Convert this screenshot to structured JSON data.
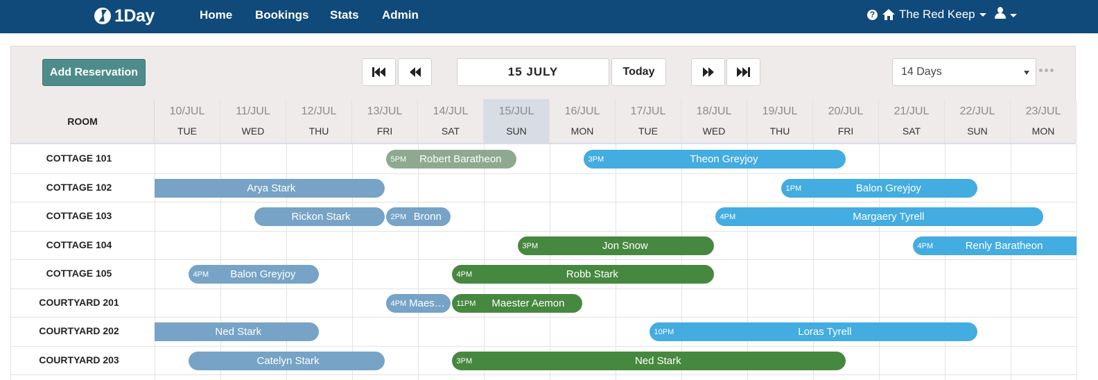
{
  "app": {
    "brand": "1Day"
  },
  "nav": {
    "home": "Home",
    "bookings": "Bookings",
    "stats": "Stats",
    "admin": "Admin"
  },
  "header": {
    "property": "The Red Keep",
    "help_glyph": "?"
  },
  "toolbar": {
    "add_reservation": "Add Reservation",
    "current_date": "15 JULY",
    "today": "Today",
    "range": "14 Days",
    "range_options": [
      "14 Days"
    ]
  },
  "grid": {
    "room_header": "ROOM",
    "today_index": 5,
    "days": [
      {
        "date": "10/JUL",
        "dow": "TUE"
      },
      {
        "date": "11/JUL",
        "dow": "WED"
      },
      {
        "date": "12/JUL",
        "dow": "THU"
      },
      {
        "date": "13/JUL",
        "dow": "FRI"
      },
      {
        "date": "14/JUL",
        "dow": "SAT"
      },
      {
        "date": "15/JUL",
        "dow": "SUN"
      },
      {
        "date": "16/JUL",
        "dow": "MON"
      },
      {
        "date": "17/JUL",
        "dow": "TUE"
      },
      {
        "date": "18/JUL",
        "dow": "WED"
      },
      {
        "date": "19/JUL",
        "dow": "THU"
      },
      {
        "date": "20/JUL",
        "dow": "FRI"
      },
      {
        "date": "21/JUL",
        "dow": "SAT"
      },
      {
        "date": "22/JUL",
        "dow": "SUN"
      },
      {
        "date": "23/JUL",
        "dow": "MON"
      }
    ],
    "rooms": [
      "COTTAGE 101",
      "COTTAGE 102",
      "COTTAGE 103",
      "COTTAGE 104",
      "COTTAGE 105",
      "COURTYARD 201",
      "COURTYARD 202",
      "COURTYARD 203"
    ]
  },
  "bookings": [
    {
      "room": 0,
      "start": 3.5,
      "end": 5.5,
      "time": "5PM",
      "name": "Robert Baratheon",
      "status": "pastgreen"
    },
    {
      "room": 0,
      "start": 6.5,
      "end": 10.5,
      "time": "3PM",
      "name": "Theon Greyjoy",
      "status": "future"
    },
    {
      "room": 1,
      "start": 0,
      "end": 3.5,
      "time": "",
      "name": "Arya Stark",
      "status": "past",
      "open": "left"
    },
    {
      "room": 1,
      "start": 9.5,
      "end": 12.5,
      "time": "1PM",
      "name": "Balon Greyjoy",
      "status": "future"
    },
    {
      "room": 2,
      "start": 1.5,
      "end": 3.5,
      "time": "",
      "name": "Rickon Stark",
      "status": "past"
    },
    {
      "room": 2,
      "start": 3.5,
      "end": 4.5,
      "time": "2PM",
      "name": "Bronn",
      "status": "past"
    },
    {
      "room": 2,
      "start": 8.5,
      "end": 13.5,
      "time": "4PM",
      "name": "Margaery Tyrell",
      "status": "future"
    },
    {
      "room": 3,
      "start": 5.5,
      "end": 8.5,
      "time": "3PM",
      "name": "Jon Snow",
      "status": "current"
    },
    {
      "room": 3,
      "start": 11.5,
      "end": 14,
      "time": "4PM",
      "name": "Renly Baratheon",
      "status": "future",
      "open": "right"
    },
    {
      "room": 4,
      "start": 0.5,
      "end": 2.5,
      "time": "4PM",
      "name": "Balon Greyjoy",
      "status": "past"
    },
    {
      "room": 4,
      "start": 4.5,
      "end": 8.5,
      "time": "4PM",
      "name": "Robb Stark",
      "status": "current"
    },
    {
      "room": 5,
      "start": 3.5,
      "end": 4.5,
      "time": "4PM",
      "name": "Maester Pycelle",
      "status": "past"
    },
    {
      "room": 5,
      "start": 4.5,
      "end": 6.5,
      "time": "11PM",
      "name": "Maester Aemon",
      "status": "current"
    },
    {
      "room": 6,
      "start": 0,
      "end": 2.5,
      "time": "",
      "name": "Ned Stark",
      "status": "past",
      "open": "left"
    },
    {
      "room": 6,
      "start": 7.5,
      "end": 12.5,
      "time": "10PM",
      "name": "Loras Tyrell",
      "status": "future"
    },
    {
      "room": 7,
      "start": 0.5,
      "end": 3.5,
      "time": "",
      "name": "Catelyn Stark",
      "status": "past"
    },
    {
      "room": 7,
      "start": 4.5,
      "end": 10.5,
      "time": "3PM",
      "name": "Ned Stark",
      "status": "current"
    }
  ]
}
